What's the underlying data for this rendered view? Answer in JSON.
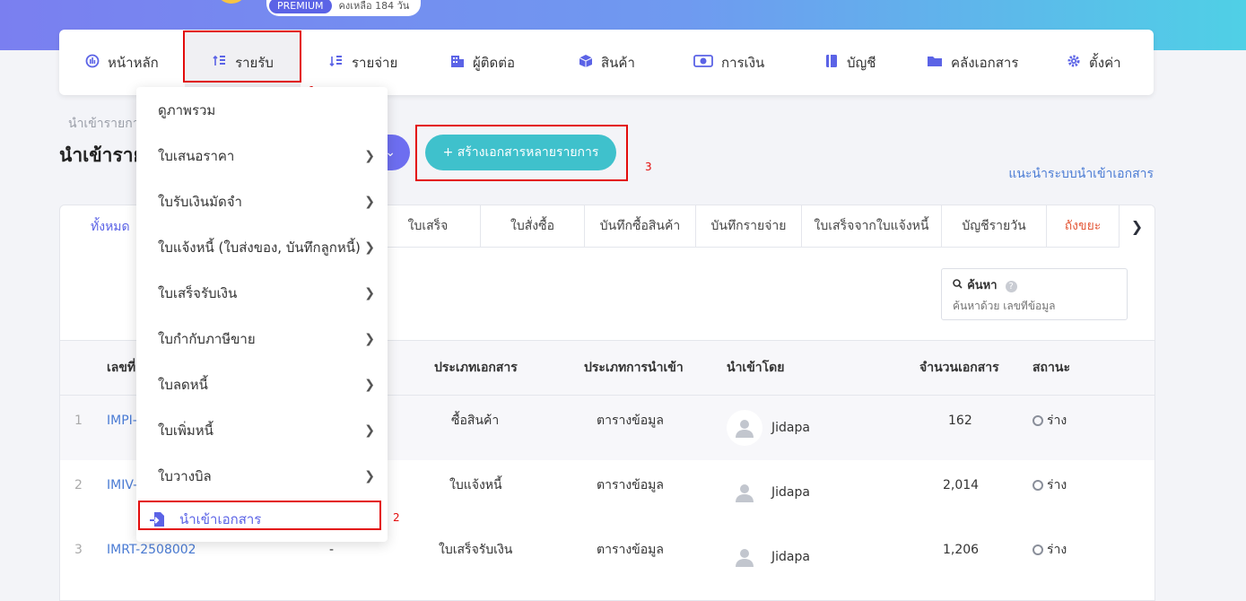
{
  "header": {
    "premium_badge": "PREMIUM",
    "premium_remaining": "คงเหลือ 184 วัน"
  },
  "nav": {
    "items": [
      {
        "label": "หน้าหลัก",
        "icon": "dashboard-icon"
      },
      {
        "label": "รายรับ",
        "icon": "income-icon"
      },
      {
        "label": "รายจ่าย",
        "icon": "expense-icon"
      },
      {
        "label": "ผู้ติดต่อ",
        "icon": "contacts-icon"
      },
      {
        "label": "สินค้า",
        "icon": "box-icon"
      },
      {
        "label": "การเงิน",
        "icon": "money-icon"
      },
      {
        "label": "บัญชี",
        "icon": "book-icon"
      },
      {
        "label": "คลังเอกสาร",
        "icon": "folder-icon"
      },
      {
        "label": "ตั้งค่า",
        "icon": "gear-icon"
      }
    ],
    "active": "รายรับ"
  },
  "dropdown": {
    "items": [
      {
        "label": "ดูภาพรวม"
      },
      {
        "label": "ใบเสนอราคา"
      },
      {
        "label": "ใบรับเงินมัดจำ"
      },
      {
        "label": "ใบแจ้งหนี้ (ใบส่งของ, บันทึกลูกหนี้)"
      },
      {
        "label": "ใบเสร็จรับเงิน"
      },
      {
        "label": "ใบกำกับภาษีขาย"
      },
      {
        "label": "ใบลดหนี้"
      },
      {
        "label": "ใบเพิ่มหนี้"
      },
      {
        "label": "ใบวางบิล"
      },
      {
        "label": "นำเข้าเอกสาร"
      }
    ]
  },
  "annotations": [
    "1",
    "2",
    "3"
  ],
  "page": {
    "breadcrumb": "นำเข้ารายการ",
    "title": "นำเข้ารายการ",
    "create_button": "+ สร้างเอกสารหลายรายการ",
    "guide_link": "แนะนำระบบนำเข้าเอกสาร"
  },
  "tabs": [
    "ทั้งหมด",
    "ใบเสร็จ",
    "ใบสั่งซื้อ",
    "บันทึกซื้อสินค้า",
    "บันทึกรายจ่าย",
    "ใบเสร็จจากใบแจ้งหนี้",
    "บัญชีรายวัน",
    "ถังขยะ"
  ],
  "search": {
    "label": "ค้นหา",
    "placeholder": "ค้นหาด้วย เลขที่ข้อมูล"
  },
  "table": {
    "headers": [
      "เลขที่",
      "ประเภทเอกสาร",
      "ประเภทการนำเข้า",
      "นำเข้าโดย",
      "จำนวนเอกสาร",
      "สถานะ"
    ],
    "rows": [
      {
        "no": "1",
        "doc_no": "IMPI-",
        "dash": "",
        "doc_type": "ซื้อสินค้า",
        "import_type": "ตารางข้อมูล",
        "by": "Jidapa",
        "count": "162",
        "status": "ร่าง"
      },
      {
        "no": "2",
        "doc_no": "IMIV-",
        "dash": "",
        "doc_type": "ใบแจ้งหนี้",
        "import_type": "ตารางข้อมูล",
        "by": "Jidapa",
        "count": "2,014",
        "status": "ร่าง"
      },
      {
        "no": "3",
        "doc_no": "IMRT-2508002",
        "dash": "-",
        "doc_type": "ใบเสร็จรับเงิน",
        "import_type": "ตารางข้อมูล",
        "by": "Jidapa",
        "count": "1,206",
        "status": "ร่าง"
      }
    ]
  },
  "colors": {
    "accent": "#5b63e6",
    "teal": "#3fc1cc",
    "highlight": "#e30c0c"
  }
}
